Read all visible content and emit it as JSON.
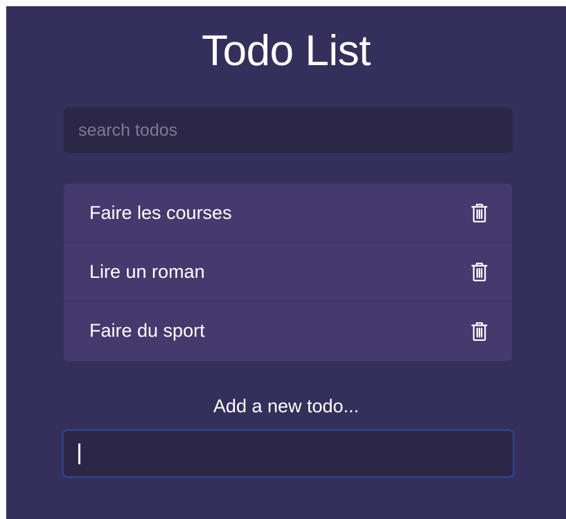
{
  "header": {
    "title": "Todo List"
  },
  "search": {
    "placeholder": "search todos",
    "value": ""
  },
  "todos": [
    {
      "text": "Faire les courses",
      "delete_icon": "trash-icon"
    },
    {
      "text": "Lire un roman",
      "delete_icon": "trash-icon"
    },
    {
      "text": "Faire du sport",
      "delete_icon": "trash-icon"
    }
  ],
  "add": {
    "label": "Add a new todo...",
    "value": ""
  },
  "colors": {
    "background": "#352f5b",
    "panel": "#443a6e",
    "input": "#2c2746",
    "focus_border": "#2f3f88",
    "text": "#ffffff"
  }
}
